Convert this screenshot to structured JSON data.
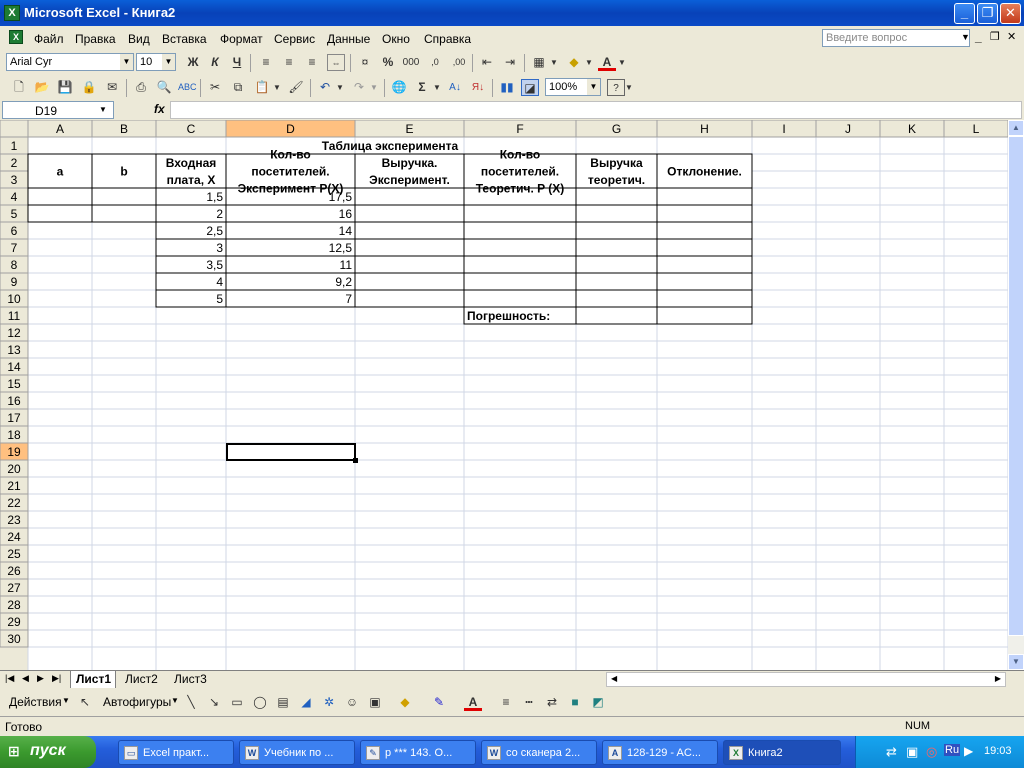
{
  "app": {
    "title": "Microsoft Excel - Книга2",
    "icon": "excel-icon"
  },
  "window_buttons": {
    "minimize": "_",
    "restore": "❐",
    "close": "✕"
  },
  "menu": {
    "items": [
      "Файл",
      "Правка",
      "Вид",
      "Вставка",
      "Формат",
      "Сервис",
      "Данные",
      "Окно",
      "Справка"
    ],
    "ask_placeholder": "Введите вопрос"
  },
  "format_toolbar": {
    "font": "Arial Cyr",
    "size": "10",
    "bold": "Ж",
    "italic": "К",
    "underline": "Ч",
    "percent": "%",
    "thousands": "000"
  },
  "standard_toolbar": {
    "zoom": "100%",
    "sigma": "Σ"
  },
  "formula_bar": {
    "name_box": "D19",
    "fx": "fx",
    "value": ""
  },
  "columns": [
    "A",
    "B",
    "C",
    "D",
    "E",
    "F",
    "G",
    "H",
    "I",
    "J",
    "K",
    "L"
  ],
  "rows": [
    "1",
    "2",
    "3",
    "4",
    "5",
    "6",
    "7",
    "8",
    "9",
    "10",
    "11",
    "12",
    "13",
    "14",
    "15",
    "16",
    "17",
    "18",
    "19",
    "20",
    "21",
    "22",
    "23",
    "24",
    "25",
    "26",
    "27",
    "28",
    "29",
    "30"
  ],
  "sheet": {
    "title": "Таблица эксперимента",
    "headers": {
      "a": "a",
      "b": "b",
      "c": "Входная плата, X",
      "d": "Кол-во посетителей. Эксперимент P(X)",
      "e": "Выручка. Эксперимент.",
      "f": "Кол-во посетителей. Теоретич. P (X)",
      "g": "Выручка теоретич.",
      "h": "Отклонение."
    },
    "data": [
      {
        "x": "1,5",
        "p": "17,5"
      },
      {
        "x": "2",
        "p": "16"
      },
      {
        "x": "2,5",
        "p": "14"
      },
      {
        "x": "3",
        "p": "12,5"
      },
      {
        "x": "3,5",
        "p": "11"
      },
      {
        "x": "4",
        "p": "9,2"
      },
      {
        "x": "5",
        "p": "7"
      }
    ],
    "error_label": "Погрешность:"
  },
  "tabs": [
    "Лист1",
    "Лист2",
    "Лист3"
  ],
  "active_tab": "Лист1",
  "draw_toolbar": {
    "actions": "Действия",
    "autoshapes": "Автофигуры"
  },
  "status": {
    "left": "Готово",
    "num": "NUM"
  },
  "taskbar": {
    "start": "пуск",
    "tasks": [
      "Excel практ...",
      "Учебник по ...",
      "p *** 143. O...",
      "со сканера 2...",
      "128-129 - AC...",
      "Книга2"
    ],
    "lang": "RU",
    "time": "19:03"
  },
  "colors": {
    "selected_header": "#ffc080",
    "grid_line": "#d0d7e5",
    "header_bg": "#ece9d8",
    "title_bar": "#0a5fd8"
  }
}
